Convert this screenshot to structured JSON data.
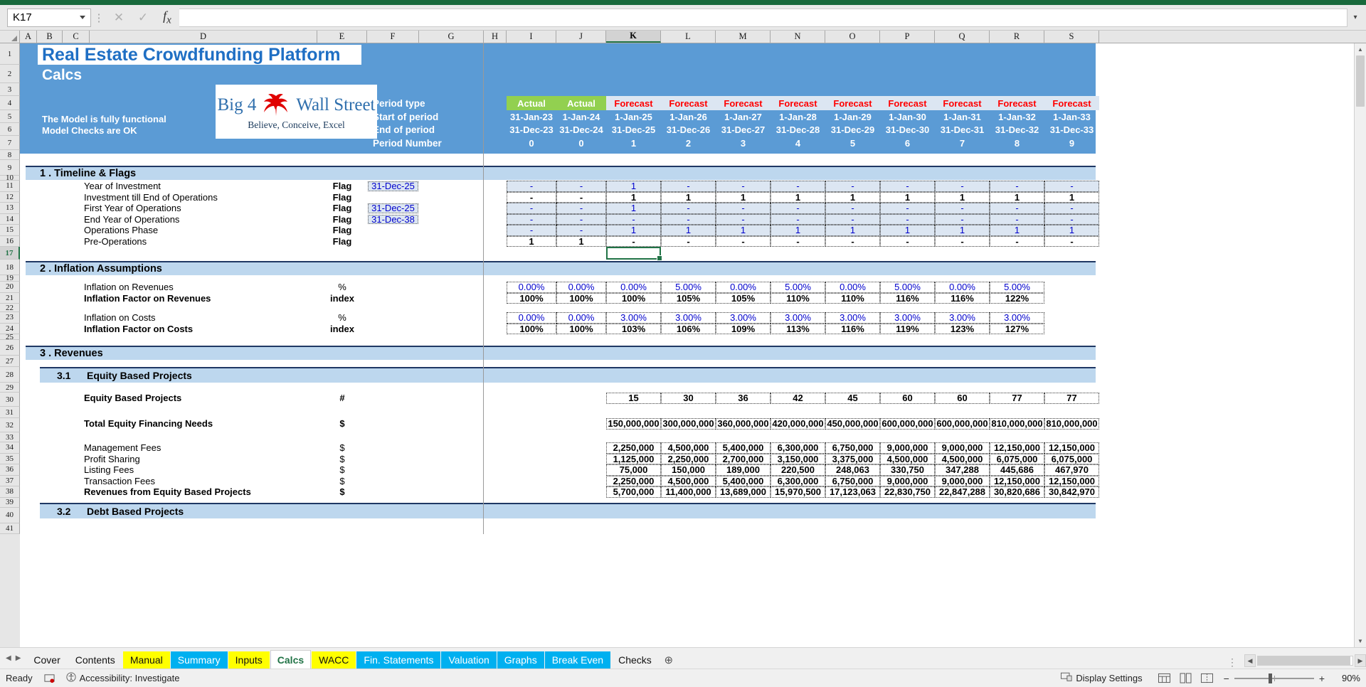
{
  "formula_bar": {
    "name_box_value": "K17",
    "formula_value": "",
    "cancel_icon": "close-icon",
    "confirm_icon": "check-icon",
    "function_icon": "fx-icon"
  },
  "columns": [
    "A",
    "B",
    "C",
    "D",
    "E",
    "F",
    "G",
    "H",
    "I",
    "J",
    "K",
    "L",
    "M",
    "N",
    "O",
    "P",
    "Q",
    "R",
    "S"
  ],
  "selected_column": "K",
  "selected_row": 17,
  "rows": [
    1,
    2,
    3,
    4,
    5,
    6,
    7,
    8,
    9,
    10,
    11,
    12,
    13,
    14,
    15,
    16,
    17,
    18,
    19,
    20,
    21,
    22,
    23,
    24,
    25,
    26,
    27,
    28,
    29,
    30,
    31,
    32,
    33,
    34,
    35,
    36,
    37,
    38,
    39,
    40,
    41
  ],
  "header": {
    "title": "Real Estate Crowdfunding Platform",
    "subtitle": "Calcs",
    "note1": "The Model is fully functional",
    "note2": "Model Checks are OK",
    "logo": {
      "text_left": "Big 4",
      "text_right": "Wall Street",
      "tagline": "Believe, Conceive, Excel",
      "bird_icon": "eagle-icon"
    }
  },
  "period_block": {
    "labels": [
      "Period type",
      "Start of period",
      "End of period",
      "Period Number"
    ],
    "period_type": [
      "Actual",
      "Actual",
      "Forecast",
      "Forecast",
      "Forecast",
      "Forecast",
      "Forecast",
      "Forecast",
      "Forecast",
      "Forecast",
      "Forecast"
    ],
    "start_of_period": [
      "31-Jan-23",
      "1-Jan-24",
      "1-Jan-25",
      "1-Jan-26",
      "1-Jan-27",
      "1-Jan-28",
      "1-Jan-29",
      "1-Jan-30",
      "1-Jan-31",
      "1-Jan-32",
      "1-Jan-33"
    ],
    "end_of_period": [
      "31-Dec-23",
      "31-Dec-24",
      "31-Dec-25",
      "31-Dec-26",
      "31-Dec-27",
      "31-Dec-28",
      "31-Dec-29",
      "31-Dec-30",
      "31-Dec-31",
      "31-Dec-32",
      "31-Dec-33"
    ],
    "period_number": [
      "0",
      "0",
      "1",
      "2",
      "3",
      "4",
      "5",
      "6",
      "7",
      "8",
      "9"
    ]
  },
  "sections": {
    "s1": "1 .  Timeline & Flags",
    "s2": "2 .  Inflation Assumptions",
    "s3": "3 .  Revenues",
    "s31_num": "3.1",
    "s31": "Equity Based Projects",
    "s32_num": "3.2",
    "s32": "Debt Based Projects"
  },
  "timeline_rows": [
    {
      "label": "Year of Investment",
      "unit": "Flag",
      "input": "31-Dec-25",
      "style": "blue",
      "values": [
        "-",
        "-",
        "1",
        "-",
        "-",
        "-",
        "-",
        "-",
        "-",
        "-",
        "-"
      ]
    },
    {
      "label": "Investment till End of Operations",
      "unit": "Flag",
      "input": "",
      "style": "plain",
      "values": [
        "-",
        "-",
        "1",
        "1",
        "1",
        "1",
        "1",
        "1",
        "1",
        "1",
        "1"
      ]
    },
    {
      "label": "First Year of Operations",
      "unit": "Flag",
      "input": "31-Dec-25",
      "style": "blue",
      "values": [
        "-",
        "-",
        "1",
        "-",
        "-",
        "-",
        "-",
        "-",
        "-",
        "-",
        "-"
      ]
    },
    {
      "label": "End Year of Operations",
      "unit": "Flag",
      "input": "31-Dec-38",
      "style": "blue",
      "values": [
        "-",
        "-",
        "-",
        "-",
        "-",
        "-",
        "-",
        "-",
        "-",
        "-",
        "-"
      ]
    },
    {
      "label": "Operations Phase",
      "unit": "Flag",
      "input": "",
      "style": "blue",
      "values": [
        "-",
        "-",
        "1",
        "1",
        "1",
        "1",
        "1",
        "1",
        "1",
        "1",
        "1"
      ]
    },
    {
      "label": "Pre-Operations",
      "unit": "Flag",
      "input": "",
      "style": "plain",
      "values": [
        "1",
        "1",
        "-",
        "-",
        "-",
        "-",
        "-",
        "-",
        "-",
        "-",
        "-"
      ]
    }
  ],
  "inflation_rows": [
    {
      "label": "Inflation on Revenues",
      "unit": "%",
      "style": "pct-blue",
      "values": [
        "0.00%",
        "0.00%",
        "0.00%",
        "5.00%",
        "0.00%",
        "5.00%",
        "0.00%",
        "5.00%",
        "0.00%",
        "5.00%",
        ""
      ]
    },
    {
      "label": "Inflation Factor on Revenues",
      "unit": "index",
      "style": "pct-bold",
      "values": [
        "100%",
        "100%",
        "100%",
        "105%",
        "105%",
        "110%",
        "110%",
        "116%",
        "116%",
        "122%",
        ""
      ]
    },
    {
      "label": "Inflation on Costs",
      "unit": "%",
      "style": "pct-blue",
      "values": [
        "0.00%",
        "0.00%",
        "3.00%",
        "3.00%",
        "3.00%",
        "3.00%",
        "3.00%",
        "3.00%",
        "3.00%",
        "3.00%",
        ""
      ]
    },
    {
      "label": "Inflation Factor on Costs",
      "unit": "index",
      "style": "pct-bold",
      "values": [
        "100%",
        "100%",
        "103%",
        "106%",
        "109%",
        "113%",
        "116%",
        "119%",
        "123%",
        "127%",
        ""
      ]
    }
  ],
  "revenue_rows": [
    {
      "label": "Equity Based Projects",
      "unit": "#",
      "bold": true,
      "values": [
        "15",
        "30",
        "36",
        "42",
        "45",
        "60",
        "60",
        "77",
        "77",
        ""
      ]
    },
    {
      "label": "Total Equity Financing Needs",
      "unit": "$",
      "bold": true,
      "values": [
        "150,000,000",
        "300,000,000",
        "360,000,000",
        "420,000,000",
        "450,000,000",
        "600,000,000",
        "600,000,000",
        "810,000,000",
        "810,000,000",
        ""
      ]
    },
    {
      "label": "Management Fees",
      "unit": "$",
      "bold": false,
      "values": [
        "2,250,000",
        "4,500,000",
        "5,400,000",
        "6,300,000",
        "6,750,000",
        "9,000,000",
        "9,000,000",
        "12,150,000",
        "12,150,000",
        ""
      ]
    },
    {
      "label": "Profit Sharing",
      "unit": "$",
      "bold": false,
      "values": [
        "1,125,000",
        "2,250,000",
        "2,700,000",
        "3,150,000",
        "3,375,000",
        "4,500,000",
        "4,500,000",
        "6,075,000",
        "6,075,000",
        ""
      ]
    },
    {
      "label": "Listing Fees",
      "unit": "$",
      "bold": false,
      "values": [
        "75,000",
        "150,000",
        "189,000",
        "220,500",
        "248,063",
        "330,750",
        "347,288",
        "445,686",
        "467,970",
        ""
      ]
    },
    {
      "label": "Transaction Fees",
      "unit": "$",
      "bold": false,
      "values": [
        "2,250,000",
        "4,500,000",
        "5,400,000",
        "6,300,000",
        "6,750,000",
        "9,000,000",
        "9,000,000",
        "12,150,000",
        "12,150,000",
        ""
      ]
    },
    {
      "label": "Revenues from Equity Based Projects",
      "unit": "$",
      "bold": true,
      "values": [
        "5,700,000",
        "11,400,000",
        "13,689,000",
        "15,970,500",
        "17,123,063",
        "22,830,750",
        "22,847,288",
        "30,820,686",
        "30,842,970",
        ""
      ]
    }
  ],
  "sheet_tabs": [
    {
      "label": "Cover",
      "style": "plain"
    },
    {
      "label": "Contents",
      "style": "plain"
    },
    {
      "label": "Manual",
      "style": "yellow"
    },
    {
      "label": "Summary",
      "style": "cyan"
    },
    {
      "label": "Inputs",
      "style": "yellow"
    },
    {
      "label": "Calcs",
      "style": "active"
    },
    {
      "label": "WACC",
      "style": "yellow"
    },
    {
      "label": "Fin. Statements",
      "style": "cyan"
    },
    {
      "label": "Valuation",
      "style": "cyan"
    },
    {
      "label": "Graphs",
      "style": "cyan"
    },
    {
      "label": "Break Even",
      "style": "cyan"
    },
    {
      "label": "Checks",
      "style": "plain"
    }
  ],
  "tab_controls": {
    "first_icon": "first-sheet-icon",
    "prev_icon": "prev-sheet-icon",
    "next_icon": "next-sheet-icon",
    "last_icon": "last-sheet-icon",
    "add_sheet_icon": "add-sheet-icon",
    "overflow_icon": "tab-overflow-icon"
  },
  "status_bar": {
    "ready_text": "Ready",
    "macro_icon": "record-macro-icon",
    "accessibility_icon": "accessibility-icon",
    "accessibility_text": "Accessibility: Investigate",
    "display_settings_icon": "display-settings-icon",
    "display_settings_text": "Display Settings",
    "view_normal_icon": "normal-view-icon",
    "view_pagelayout_icon": "page-layout-view-icon",
    "view_pagebreak_icon": "page-break-view-icon",
    "zoom_out_icon": "zoom-out-icon",
    "zoom_in_icon": "zoom-in-icon",
    "zoom_level": "90%"
  },
  "colors": {
    "excel_green": "#18693c",
    "header_blue": "#5b9bd5",
    "actual_green": "#92d050",
    "forecast_bg": "#dce6f2",
    "forecast_text": "#ff0000",
    "section_blue": "#bdd7ee",
    "input_text": "#0000cc",
    "selection": "#217346"
  }
}
